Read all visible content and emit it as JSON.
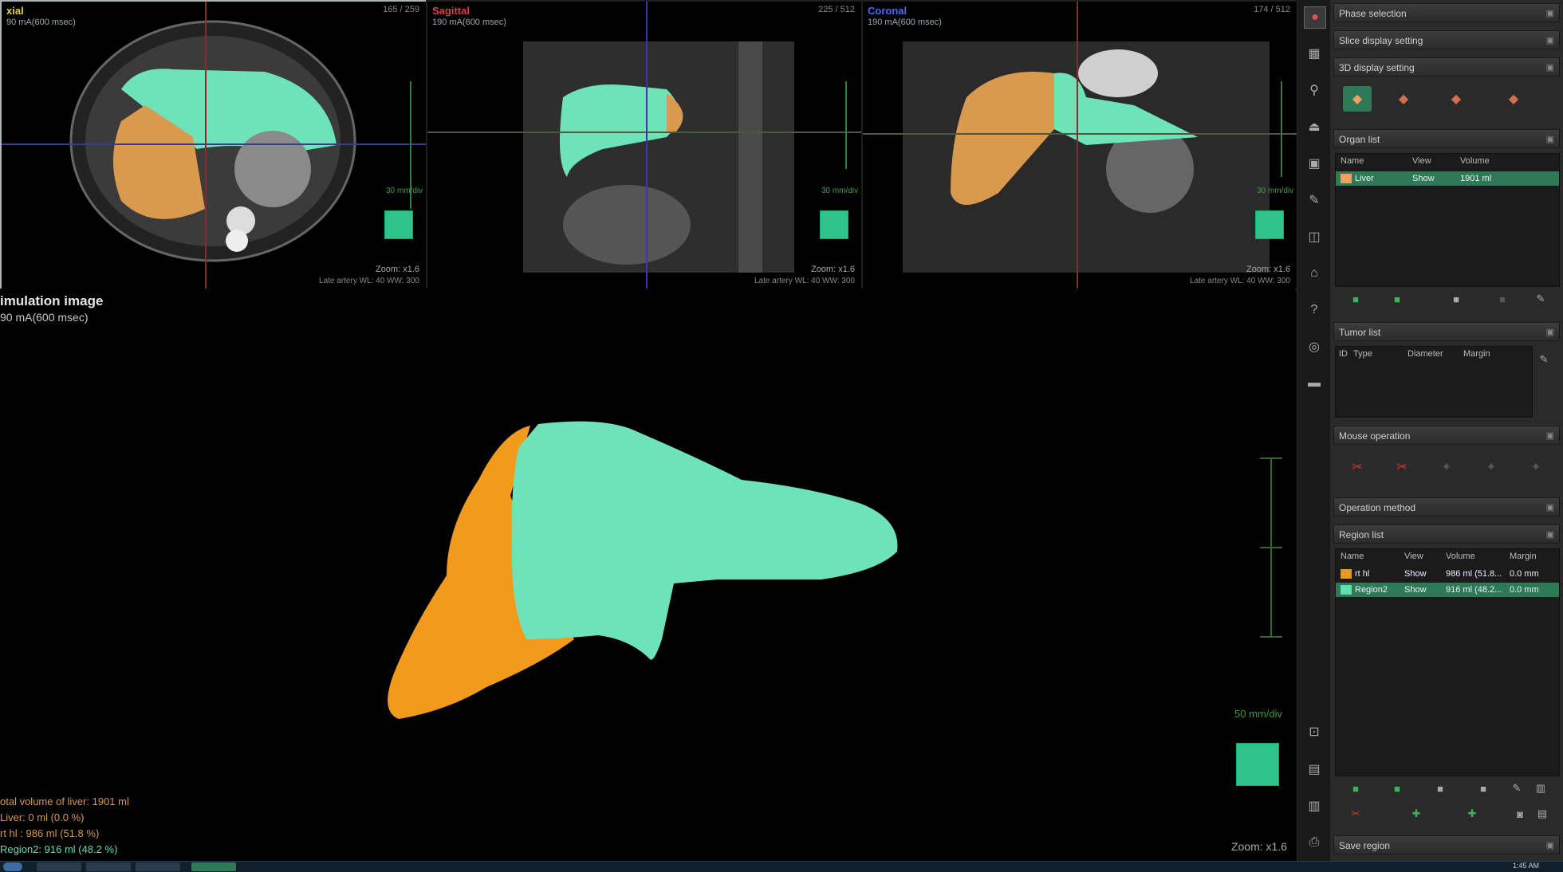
{
  "viewports": {
    "axial": {
      "title": "xial",
      "sub": "90 mA(600 msec)",
      "index": "165 / 259",
      "zoom": "Zoom: x1.6",
      "ww": "Late artery WL: 40  WW: 300",
      "mm": "30 mm/div"
    },
    "sagittal": {
      "title": "Sagittal",
      "sub": "190 mA(600 msec)",
      "index": "225 / 512",
      "zoom": "Zoom: x1.6",
      "ww": "Late artery WL: 40  WW: 300",
      "mm": "30 mm/div"
    },
    "coronal": {
      "title": "Coronal",
      "sub": "190 mA(600 msec)",
      "index": "174 / 512",
      "zoom": "Zoom: x1.6",
      "ww": "Late artery WL: 40  WW: 300",
      "mm": "30 mm/div"
    }
  },
  "main": {
    "title": "imulation image",
    "subtitle": "90 mA(600 msec)",
    "stats": [
      "otal volume of liver: 1901 ml",
      "Liver: 0 ml (0.0 %)",
      "rt hl : 986 ml (51.8 %)",
      "Region2: 916 ml (48.2 %)"
    ],
    "mm_per_div": "50 mm/div",
    "zoom": "Zoom: x1.6"
  },
  "panel": {
    "phase_selection": "Phase selection",
    "slice_display": "Slice display setting",
    "display_3d": "3D display setting",
    "organ_list": {
      "title": "Organ list",
      "headers": [
        "Name",
        "View",
        "Volume"
      ],
      "rows": [
        {
          "name": "Liver",
          "view": "Show",
          "volume": "1901 ml",
          "color": "#f0a060"
        }
      ]
    },
    "tumor_list": {
      "title": "Tumor list",
      "headers": [
        "ID",
        "Type",
        "Diameter",
        "Margin"
      ]
    },
    "mouse_operation": "Mouse operation",
    "operation_method": "Operation method",
    "region_list": {
      "title": "Region list",
      "headers": [
        "Name",
        "View",
        "Volume",
        "Margin"
      ],
      "rows": [
        {
          "name": "rt hl",
          "view": "Show",
          "volume": "986 ml (51.8...",
          "margin": "0.0 mm",
          "color": "#e89a20"
        },
        {
          "name": "Region2",
          "view": "Show",
          "volume": "916 ml (48.2...",
          "margin": "0.0 mm",
          "color": "#5ee0b0"
        }
      ]
    },
    "save_region": "Save region"
  },
  "colors": {
    "liver_orange": "#f29a1c",
    "liver_green": "#6fe3b8",
    "accent": "#2f7a56"
  },
  "taskbar": {
    "clock": "1:45 AM"
  }
}
